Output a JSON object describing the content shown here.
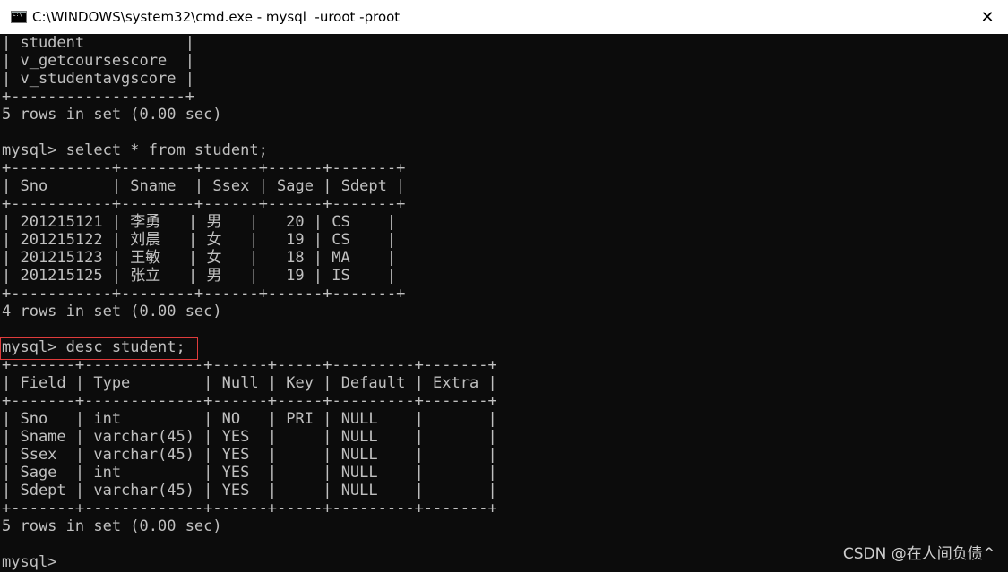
{
  "window": {
    "title": "C:\\WINDOWS\\system32\\cmd.exe - mysql  -uroot -proot",
    "close_glyph": "✕"
  },
  "console": {
    "lines": [
      "| student           |",
      "| v_getcoursescore  |",
      "| v_studentavgscore |",
      "+-------------------+",
      "5 rows in set (0.00 sec)",
      "",
      "mysql> select * from student;",
      "+-----------+--------+------+------+-------+",
      "| Sno       | Sname  | Ssex | Sage | Sdept |",
      "+-----------+--------+------+------+-------+",
      "| 201215121 | 李勇   | 男   |   20 | CS    |",
      "| 201215122 | 刘晨   | 女   |   19 | CS    |",
      "| 201215123 | 王敏   | 女   |   18 | MA    |",
      "| 201215125 | 张立   | 男   |   19 | IS    |",
      "+-----------+--------+------+------+-------+",
      "4 rows in set (0.00 sec)",
      "",
      "mysql> desc student;",
      "+-------+-------------+------+-----+---------+-------+",
      "| Field | Type        | Null | Key | Default | Extra |",
      "+-------+-------------+------+-----+---------+-------+",
      "| Sno   | int         | NO   | PRI | NULL    |       |",
      "| Sname | varchar(45) | YES  |     | NULL    |       |",
      "| Ssex  | varchar(45) | YES  |     | NULL    |       |",
      "| Sage  | int         | YES  |     | NULL    |       |",
      "| Sdept | varchar(45) | YES  |     | NULL    |       |",
      "+-------+-------------+------+-----+---------+-------+",
      "5 rows in set (0.00 sec)",
      "",
      "mysql>"
    ],
    "highlight_color": "#e03c3c"
  },
  "watermark": {
    "text": "CSDN @在人间负债^"
  }
}
